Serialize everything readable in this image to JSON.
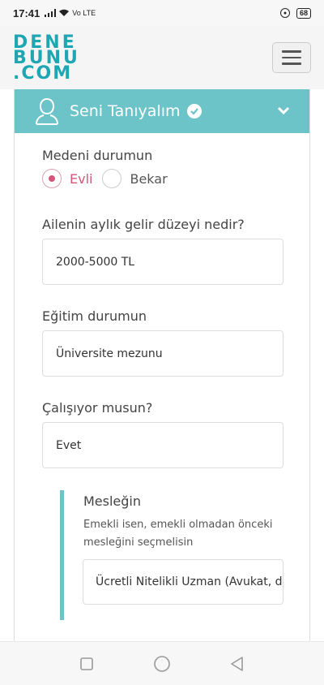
{
  "status_bar": {
    "time": "17:41",
    "network": "Vo LTE",
    "battery": "68"
  },
  "header": {
    "logo_line1": "DENE",
    "logo_line2": "BUNU",
    "logo_line3": ".COM"
  },
  "section": {
    "title": "Seni Tanıyalım"
  },
  "marital": {
    "label": "Medeni durumun",
    "options": [
      "Evli",
      "Bekar"
    ],
    "selected": "Evli"
  },
  "income": {
    "label": "Ailenin aylık gelir düzeyi nedir?",
    "value": "2000-5000 TL"
  },
  "education": {
    "label": "Eğitim durumun",
    "value": "Üniversite mezunu"
  },
  "working": {
    "label": "Çalışıyor musun?",
    "value": "Evet"
  },
  "profession": {
    "label": "Mesleğin",
    "help": "Emekli isen, emekli olmadan önceki mesleğini seçmelisin",
    "value": "Ücretli Nitelikli Uzman (Avukat, d"
  },
  "colors": {
    "accent": "#6cc3c8",
    "selected_radio": "#d4567a",
    "logo": "#1fa6b3"
  }
}
